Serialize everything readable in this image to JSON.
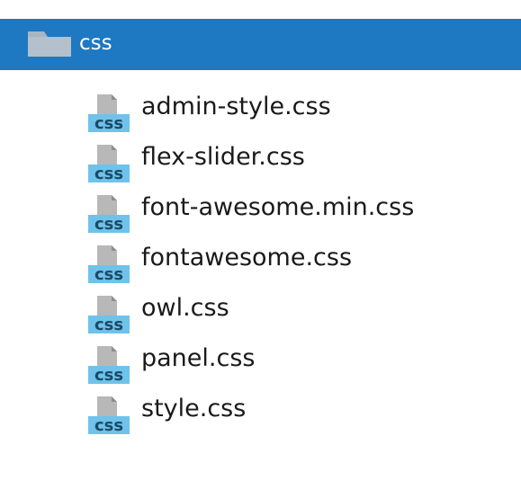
{
  "folder": {
    "name": "css",
    "icon": "folder-icon",
    "selected_color": "#1e78c2"
  },
  "files": [
    {
      "name": "admin-style.css",
      "icon": "css-file-icon"
    },
    {
      "name": "flex-slider.css",
      "icon": "css-file-icon"
    },
    {
      "name": "font-awesome.min.css",
      "icon": "css-file-icon"
    },
    {
      "name": "fontawesome.css",
      "icon": "css-file-icon"
    },
    {
      "name": "owl.css",
      "icon": "css-file-icon"
    },
    {
      "name": "panel.css",
      "icon": "css-file-icon"
    },
    {
      "name": "style.css",
      "icon": "css-file-icon"
    }
  ],
  "icon_badge_text": "css"
}
